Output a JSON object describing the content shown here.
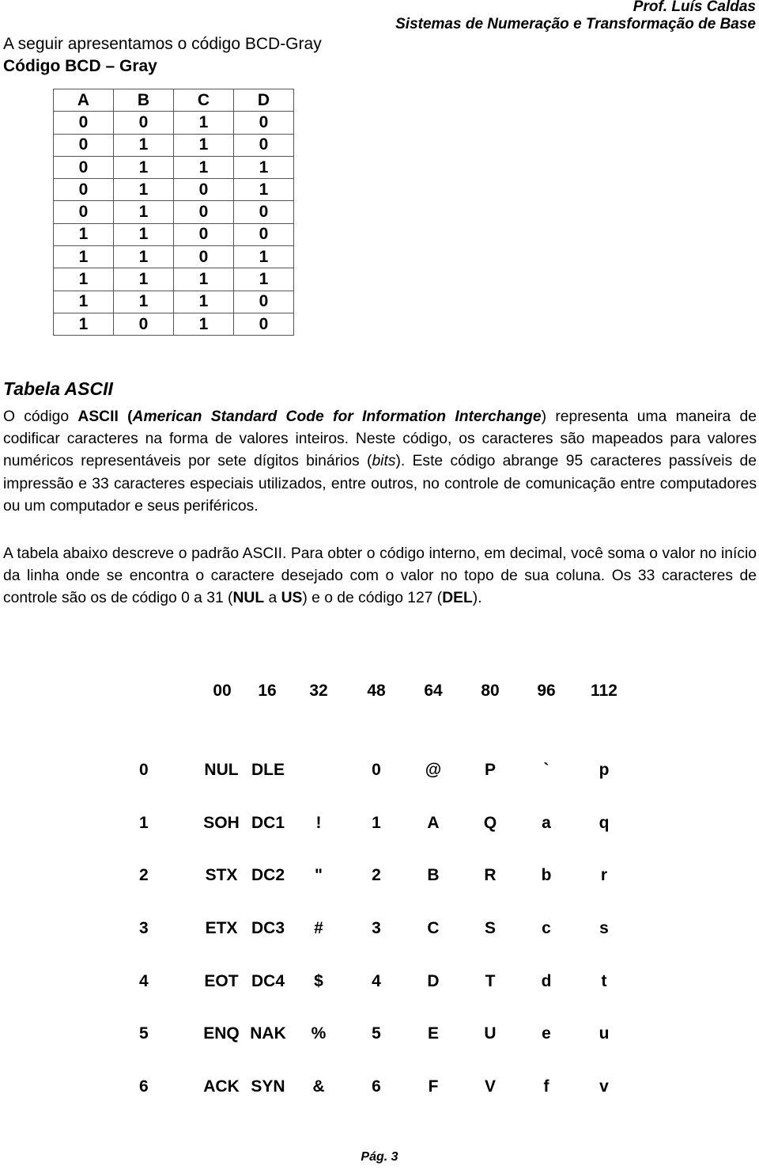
{
  "header": {
    "author": "Prof. Luís Caldas",
    "subject": "Sistemas de Numeração e Transformação de Base"
  },
  "intro": {
    "line": "A seguir apresentamos o código BCD-Gray",
    "title": "Código BCD – Gray"
  },
  "bcd_table": {
    "headers": [
      "A",
      "B",
      "C",
      "D"
    ],
    "rows": [
      [
        "0",
        "0",
        "1",
        "0"
      ],
      [
        "0",
        "1",
        "1",
        "0"
      ],
      [
        "0",
        "1",
        "1",
        "1"
      ],
      [
        "0",
        "1",
        "0",
        "1"
      ],
      [
        "0",
        "1",
        "0",
        "0"
      ],
      [
        "1",
        "1",
        "0",
        "0"
      ],
      [
        "1",
        "1",
        "0",
        "1"
      ],
      [
        "1",
        "1",
        "1",
        "1"
      ],
      [
        "1",
        "1",
        "1",
        "0"
      ],
      [
        "1",
        "0",
        "1",
        "0"
      ]
    ]
  },
  "ascii_section": {
    "title": "Tabela ASCII",
    "p1": {
      "t1": "O código ",
      "b1": "ASCII",
      "t2": " (",
      "bi1": "American Standard Code for Information Interchange",
      "t3": ") representa uma maneira de codificar caracteres na forma de valores inteiros. Neste código, os caracteres são mapeados para valores numéricos representáveis por sete dígitos binários (",
      "i1": "bits",
      "t4": "). Este código abrange 95 caracteres passíveis de impressão e 33 caracteres especiais utilizados, entre outros, no controle de comunicação entre computadores ou um computador e seus periféricos."
    },
    "p2": {
      "t1": "A tabela abaixo descreve o padrão ASCII. Para obter o código interno, em decimal, você soma o valor no início da linha onde se encontra o caractere desejado com o valor no topo de sua coluna. Os 33 caracteres de controle são os de código 0 a 31 (",
      "b1": "NUL",
      "t2": " a ",
      "b2": "US",
      "t3": ") e o de código 127 (",
      "b3": "DEL",
      "t4": ")."
    }
  },
  "ascii_table": {
    "column_headers": [
      "00",
      "16",
      "32",
      "48",
      "64",
      "80",
      "96",
      "112"
    ],
    "rows": [
      {
        "offset": "0",
        "cells": [
          "NUL",
          "DLE",
          "",
          "0",
          "@",
          "P",
          "`",
          "p"
        ]
      },
      {
        "offset": "1",
        "cells": [
          "SOH",
          "DC1",
          "!",
          "1",
          "A",
          "Q",
          "a",
          "q"
        ]
      },
      {
        "offset": "2",
        "cells": [
          "STX",
          "DC2",
          "\"",
          "2",
          "B",
          "R",
          "b",
          "r"
        ]
      },
      {
        "offset": "3",
        "cells": [
          "ETX",
          "DC3",
          "#",
          "3",
          "C",
          "S",
          "c",
          "s"
        ]
      },
      {
        "offset": "4",
        "cells": [
          "EOT",
          "DC4",
          "$",
          "4",
          "D",
          "T",
          "d",
          "t"
        ]
      },
      {
        "offset": "5",
        "cells": [
          "ENQ",
          "NAK",
          "%",
          "5",
          "E",
          "U",
          "e",
          "u"
        ]
      },
      {
        "offset": "6",
        "cells": [
          "ACK",
          "SYN",
          "&",
          "6",
          "F",
          "V",
          "f",
          "v"
        ]
      }
    ]
  },
  "footer": {
    "page": "Pág. 3"
  }
}
